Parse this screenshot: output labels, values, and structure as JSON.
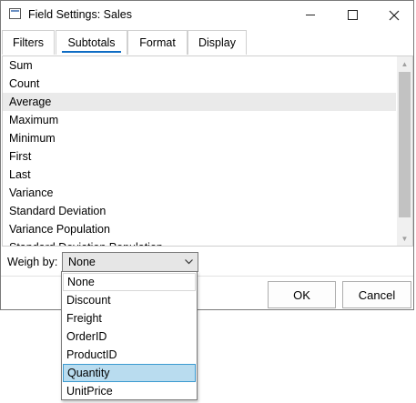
{
  "window": {
    "title": "Field Settings: Sales",
    "minimize_icon": "minimize-icon",
    "maximize_icon": "maximize-icon",
    "close_icon": "close-icon"
  },
  "tabs": [
    {
      "label": "Filters"
    },
    {
      "label": "Subtotals",
      "active": true
    },
    {
      "label": "Format"
    },
    {
      "label": "Display"
    }
  ],
  "subtotals": {
    "items": [
      "Sum",
      "Count",
      "Average",
      "Maximum",
      "Minimum",
      "First",
      "Last",
      "Variance",
      "Standard Deviation",
      "Variance Population",
      "Standard Deviation Population"
    ],
    "selected": "Average"
  },
  "weigh_by": {
    "label": "Weigh by:",
    "value": "None",
    "options": [
      "None",
      "Discount",
      "Freight",
      "OrderID",
      "ProductID",
      "Quantity",
      "UnitPrice"
    ],
    "hovered": "Quantity"
  },
  "buttons": {
    "ok": "OK",
    "cancel": "Cancel"
  },
  "colors": {
    "tab_underline": "#0e6cc4",
    "dropdown_highlight": "#b9dcef",
    "selected_row": "#eaeaea"
  }
}
